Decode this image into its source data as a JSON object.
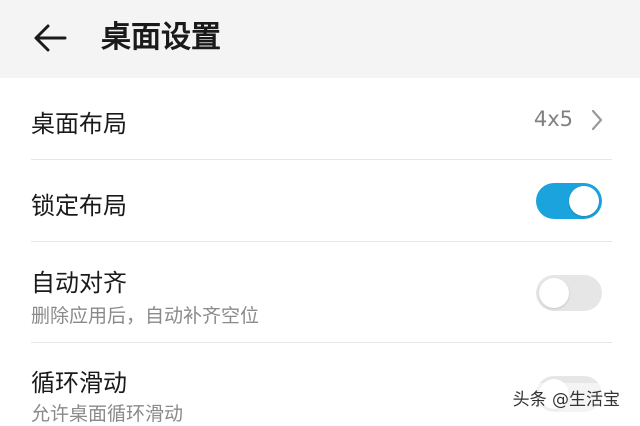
{
  "header": {
    "title": "桌面设置",
    "back_icon": "arrow-left-icon"
  },
  "settings": {
    "layout": {
      "label": "桌面布局",
      "value": "4x5",
      "icon": "chevron-right-icon"
    },
    "lock_layout": {
      "label": "锁定布局",
      "state": "on"
    },
    "auto_align": {
      "label": "自动对齐",
      "description": "删除应用后，自动补齐空位",
      "state": "off"
    },
    "loop_scroll": {
      "label": "循环滑动",
      "description": "允许桌面循环滑动",
      "state": "off"
    }
  },
  "watermark": {
    "text": "头条 @生活宝"
  },
  "colors": {
    "toggle_on": "#1aa3dc",
    "toggle_off": "#e6e6e6",
    "header_bg": "#f4f4f4"
  }
}
